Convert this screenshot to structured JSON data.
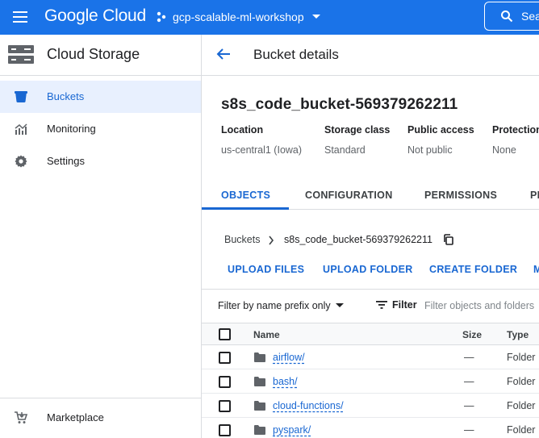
{
  "topbar": {
    "logo": "Google Cloud",
    "project": "gcp-scalable-ml-workshop",
    "search_label": "Sea"
  },
  "sidebar": {
    "title": "Cloud Storage",
    "items": [
      {
        "label": "Buckets",
        "icon": "bucket-icon",
        "active": true
      },
      {
        "label": "Monitoring",
        "icon": "monitoring-chart-icon",
        "active": false
      },
      {
        "label": "Settings",
        "icon": "gear-icon",
        "active": false
      }
    ],
    "footer_item": {
      "label": "Marketplace",
      "icon": "cart-icon"
    }
  },
  "main": {
    "header_title": "Bucket details",
    "bucket_name": "s8s_code_bucket-569379262211",
    "properties": [
      {
        "label": "Location",
        "value": "us-central1 (Iowa)"
      },
      {
        "label": "Storage class",
        "value": "Standard"
      },
      {
        "label": "Public access",
        "value": "Not public"
      },
      {
        "label": "Protection",
        "value": "None"
      }
    ],
    "tabs": [
      {
        "label": "OBJECTS",
        "active": true
      },
      {
        "label": "CONFIGURATION",
        "active": false
      },
      {
        "label": "PERMISSIONS",
        "active": false
      },
      {
        "label": "PI",
        "active": false
      }
    ],
    "breadcrumb": {
      "root": "Buckets",
      "current": "s8s_code_bucket-569379262211"
    },
    "actions": [
      "UPLOAD FILES",
      "UPLOAD FOLDER",
      "CREATE FOLDER",
      "M"
    ],
    "filter": {
      "select_label": "Filter by name prefix only",
      "button_label": "Filter",
      "placeholder": "Filter objects and folders"
    },
    "table": {
      "columns": [
        "Name",
        "Size",
        "Type"
      ],
      "rows": [
        {
          "name": "airflow/",
          "size": "—",
          "type": "Folder"
        },
        {
          "name": "bash/",
          "size": "—",
          "type": "Folder"
        },
        {
          "name": "cloud-functions/",
          "size": "—",
          "type": "Folder"
        },
        {
          "name": "pyspark/",
          "size": "—",
          "type": "Folder"
        }
      ]
    }
  },
  "colors": {
    "brand_blue": "#1a73e8",
    "active_text": "#1967d2",
    "active_bg": "#e8f0fe"
  }
}
